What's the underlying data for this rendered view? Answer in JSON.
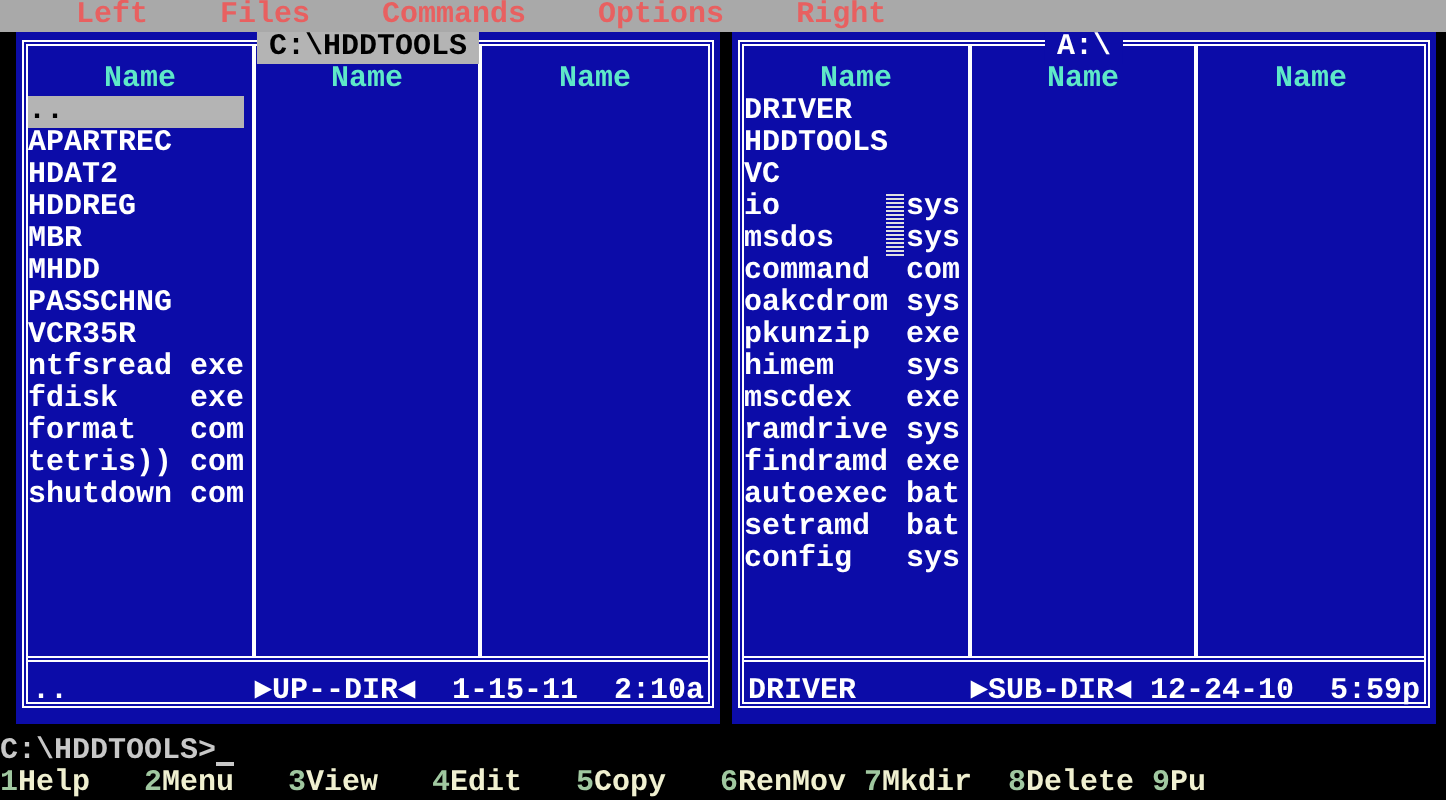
{
  "menu": [
    {
      "label": "Left"
    },
    {
      "label": "Files"
    },
    {
      "label": "Commands"
    },
    {
      "label": "Options"
    },
    {
      "label": "Right"
    }
  ],
  "panels": [
    {
      "title": "C:\\HDDTOOLS",
      "active": true,
      "columns": [
        {
          "heading": "Name",
          "files": [
            {
              "name": "..",
              "selected": true,
              "hidden": false
            },
            {
              "name": "APARTREC",
              "selected": false,
              "hidden": false
            },
            {
              "name": "HDAT2",
              "selected": false,
              "hidden": false
            },
            {
              "name": "HDDREG",
              "selected": false,
              "hidden": false
            },
            {
              "name": "MBR",
              "selected": false,
              "hidden": false
            },
            {
              "name": "MHDD",
              "selected": false,
              "hidden": false
            },
            {
              "name": "PASSCHNG",
              "selected": false,
              "hidden": false
            },
            {
              "name": "VCR35R",
              "selected": false,
              "hidden": false
            },
            {
              "name": "ntfsread",
              "ext": "exe",
              "selected": false,
              "hidden": false
            },
            {
              "name": "fdisk",
              "ext": "exe",
              "selected": false,
              "hidden": false
            },
            {
              "name": "format",
              "ext": "com",
              "selected": false,
              "hidden": false
            },
            {
              "name": "tetris))",
              "ext": "com",
              "selected": false,
              "hidden": false
            },
            {
              "name": "shutdown",
              "ext": "com",
              "selected": false,
              "hidden": false
            }
          ]
        },
        {
          "heading": "Name"
        },
        {
          "heading": "Name"
        }
      ],
      "footer": {
        "name": "..",
        "info": "►UP--DIR◄",
        "date": "1-15-11",
        "time": "2:10a"
      }
    },
    {
      "title": "A:\\",
      "active": false,
      "columns": [
        {
          "heading": "Name",
          "files": [
            {
              "name": "DRIVER",
              "selected": false,
              "hidden": false
            },
            {
              "name": "HDDTOOLS",
              "selected": false,
              "hidden": false
            },
            {
              "name": "VC",
              "selected": false,
              "hidden": false
            },
            {
              "name": "io",
              "ext": "sys",
              "selected": false,
              "hidden": true
            },
            {
              "name": "msdos",
              "ext": "sys",
              "selected": false,
              "hidden": true
            },
            {
              "name": "command",
              "ext": "com",
              "selected": false,
              "hidden": false
            },
            {
              "name": "oakcdrom",
              "ext": "sys",
              "selected": false,
              "hidden": false
            },
            {
              "name": "pkunzip",
              "ext": "exe",
              "selected": false,
              "hidden": false
            },
            {
              "name": "himem",
              "ext": "sys",
              "selected": false,
              "hidden": false
            },
            {
              "name": "mscdex",
              "ext": "exe",
              "selected": false,
              "hidden": false
            },
            {
              "name": "ramdrive",
              "ext": "sys",
              "selected": false,
              "hidden": false
            },
            {
              "name": "findramd",
              "ext": "exe",
              "selected": false,
              "hidden": false
            },
            {
              "name": "autoexec",
              "ext": "bat",
              "selected": false,
              "hidden": false
            },
            {
              "name": "setramd",
              "ext": "bat",
              "selected": false,
              "hidden": false
            },
            {
              "name": "config",
              "ext": "sys",
              "selected": false,
              "hidden": false
            }
          ]
        },
        {
          "heading": "Name"
        },
        {
          "heading": "Name"
        }
      ],
      "footer": {
        "name": "DRIVER",
        "info": "►SUB-DIR◄",
        "date": "12-24-10",
        "time": "5:59p"
      }
    }
  ],
  "command_line": {
    "prompt": "C:\\HDDTOOLS>"
  },
  "keys": [
    {
      "number": "1",
      "label": "Help"
    },
    {
      "number": "2",
      "label": "Menu"
    },
    {
      "number": "3",
      "label": "View"
    },
    {
      "number": "4",
      "label": "Edit"
    },
    {
      "number": "5",
      "label": "Copy"
    },
    {
      "number": "6",
      "label": "RenMov"
    },
    {
      "number": "7",
      "label": "Mkdir"
    },
    {
      "number": "8",
      "label": "Delete"
    },
    {
      "number": "9",
      "label": "Pu"
    }
  ]
}
